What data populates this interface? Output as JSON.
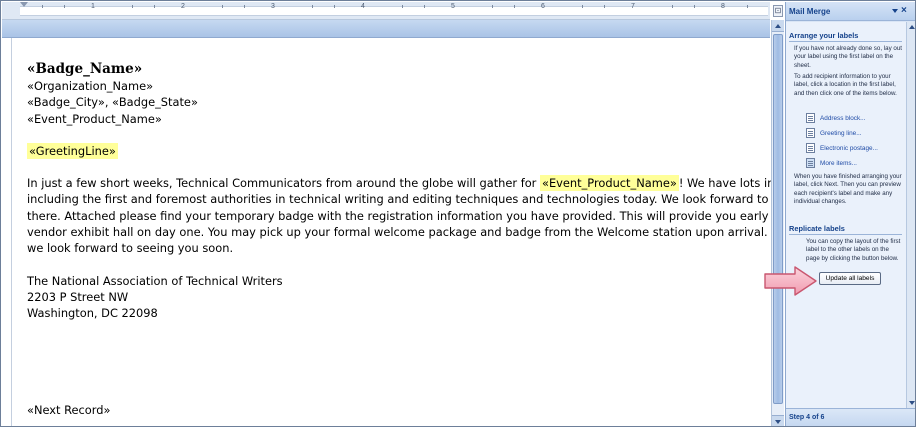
{
  "ruler": {
    "numbers": [
      "1",
      "2",
      "3",
      "4",
      "5",
      "6",
      "7",
      "8"
    ]
  },
  "document": {
    "badge_name": "«Badge_Name»",
    "organization": "«Organization_Name»",
    "city_state_prefix": "«Badge_City», «Badge_State»",
    "event_product": "«Event_Product_Name»",
    "greeting": "«GreetingLine»",
    "body": {
      "line1_before": "In just a few short weeks, Technical Communicators from around the globe will gather for ",
      "line1_field": "«Event_Product_Name»",
      "line1_after": "!  We have lots in store f",
      "line2": "including the first and foremost authorities in technical writing and editing techniques and technologies today.  We look forward to seeing y",
      "line3": "there.  Attached please find your temporary badge with the registration information you have provided.  This will provide you early access t",
      "line4": "vendor exhibit hall on day one.  You may pick up your formal welcome package and badge from the Welcome station upon arrival.  Once ag",
      "line5": "we look forward to seeing you soon."
    },
    "signature": {
      "org": "The National Association of Technical Writers",
      "street": "2203 P Street NW",
      "city": "Washington, DC 22098"
    },
    "next_record": "«Next Record»"
  },
  "pane": {
    "title": "Mail Merge",
    "close_glyph": "×",
    "arrange": {
      "heading": "Arrange your labels",
      "intro": "If you have not already done so, lay out your label using the first label on the sheet.",
      "instructions": "To add recipient information to your label, click a location in the first label, and then click one of the items below.",
      "links": [
        {
          "label": "Address block...",
          "icon": "address-block-icon"
        },
        {
          "label": "Greeting line...",
          "icon": "greeting-line-icon"
        },
        {
          "label": "Electronic postage...",
          "icon": "postage-icon"
        },
        {
          "label": "More items...",
          "icon": "more-items-icon"
        }
      ],
      "finished": "When you have finished arranging your label, click Next. Then you can preview each recipient's label and make any individual changes."
    },
    "replicate": {
      "heading": "Replicate labels",
      "text": "You can copy the layout of the first label to the other labels on the page by clicking the button below.",
      "button": "Update all labels"
    },
    "step": "Step 4 of 6"
  },
  "colors": {
    "highlight": "#ffff99",
    "pane_heading": "#15428b",
    "link": "#1f4ba6",
    "callout_arrow": "#f4a7b9"
  }
}
